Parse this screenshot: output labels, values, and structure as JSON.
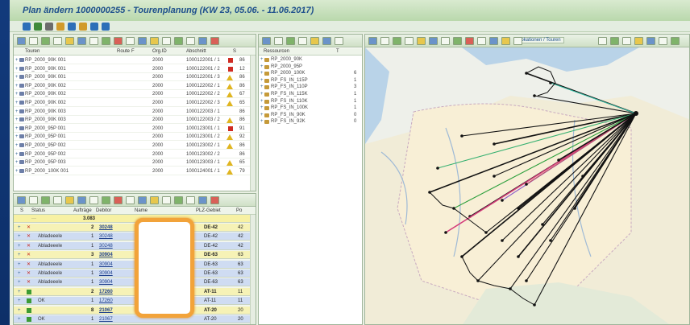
{
  "window": {
    "title": "Plan ändern 1000000255 - Tourenplanung (KW 23, 05.06. - 11.06.2017)"
  },
  "toolbar_icons": [
    "save-icon",
    "refresh-icon",
    "settings-icon",
    "calendar-icon",
    "truck-icon",
    "folder-icon",
    "print-icon",
    "exit-icon"
  ],
  "tours": {
    "columns": [
      "Touren",
      "Route",
      "F",
      "Org.ID",
      "Abschnitt",
      "S"
    ],
    "rows": [
      {
        "name": "RP_2000_90K 001",
        "org": "2000",
        "sect": "1000122001 / 1",
        "status": "red",
        "n": "86"
      },
      {
        "name": "RP_2000_90K 001",
        "org": "2000",
        "sect": "1000122001 / 2",
        "status": "red",
        "n": "12"
      },
      {
        "name": "RP_2000_90K 001",
        "org": "2000",
        "sect": "1000122001 / 3",
        "status": "warn",
        "n": "86"
      },
      {
        "name": "RP_2000_90K 002",
        "org": "2000",
        "sect": "1000122002 / 1",
        "status": "warn",
        "n": "86"
      },
      {
        "name": "RP_2000_90K 002",
        "org": "2000",
        "sect": "1000122002 / 2",
        "status": "warn",
        "n": "67"
      },
      {
        "name": "RP_2000_90K 002",
        "org": "2000",
        "sect": "1000122002 / 3",
        "status": "warn",
        "n": "65"
      },
      {
        "name": "RP_2000_90K 003",
        "org": "2000",
        "sect": "1000122003 / 1",
        "status": "",
        "n": "86"
      },
      {
        "name": "RP_2000_90K 003",
        "org": "2000",
        "sect": "1000122003 / 2",
        "status": "warn",
        "n": "86"
      },
      {
        "name": "RP_2000_95P 001",
        "org": "2000",
        "sect": "1000123001 / 1",
        "status": "red",
        "n": "91"
      },
      {
        "name": "RP_2000_95P 001",
        "org": "2000",
        "sect": "1000123001 / 2",
        "status": "warn",
        "n": "92"
      },
      {
        "name": "RP_2000_95P 002",
        "org": "2000",
        "sect": "1000123002 / 1",
        "status": "warn",
        "n": "86"
      },
      {
        "name": "RP_2000_95P 002",
        "org": "2000",
        "sect": "1000123002 / 2",
        "status": "",
        "n": "86"
      },
      {
        "name": "RP_2000_95P 003",
        "org": "2000",
        "sect": "1000123003 / 1",
        "status": "warn",
        "n": "65"
      },
      {
        "name": "RP_2000_100K 001",
        "org": "2000",
        "sect": "1000124001 / 1",
        "status": "warn",
        "n": "79"
      }
    ]
  },
  "resources": {
    "columns": [
      "Ressourcen",
      "T"
    ],
    "rows": [
      {
        "name": "RP_2000_90K",
        "n": ""
      },
      {
        "name": "RP_2000_95P",
        "n": ""
      },
      {
        "name": "RP_2000_100K",
        "n": "6"
      },
      {
        "name": "RP_FS_IN_115P",
        "n": "1"
      },
      {
        "name": "RP_FS_IN_110P",
        "n": "3"
      },
      {
        "name": "RP_FS_IN_115K",
        "n": "1"
      },
      {
        "name": "RP_FS_IN_110K",
        "n": "1"
      },
      {
        "name": "RP_FS_IN_100K",
        "n": "1"
      },
      {
        "name": "RP_FS_IN_90K",
        "n": "0"
      },
      {
        "name": "RP_FS_IN_92K",
        "n": "0"
      }
    ]
  },
  "orders": {
    "columns": [
      "S",
      "Status",
      "Aufträge",
      "Debitor",
      "Name",
      "PLZ-Gebiet",
      "Po"
    ],
    "total": "3.083",
    "rows": [
      {
        "status": "",
        "mark": "x",
        "count": "2",
        "debitor": "30248",
        "plz": "DE-42",
        "po": "42",
        "color": "#f6f2b6",
        "bold": true
      },
      {
        "status": "Abladeeele",
        "mark": "x",
        "count": "1",
        "debitor": "30248",
        "plz": "DE-42",
        "po": "42",
        "color": "#cfdcf2"
      },
      {
        "status": "Abladeeele",
        "mark": "x",
        "count": "1",
        "debitor": "30248",
        "plz": "DE-42",
        "po": "42",
        "color": "#cfdcf2"
      },
      {
        "status": "",
        "mark": "x",
        "count": "3",
        "debitor": "30904",
        "plz": "DE-63",
        "po": "63",
        "color": "#f6f2b6",
        "bold": true
      },
      {
        "status": "Abladeeele",
        "mark": "x",
        "count": "1",
        "debitor": "30904",
        "plz": "DE-63",
        "po": "63",
        "color": "#cfdcf2"
      },
      {
        "status": "Abladeeele",
        "mark": "x",
        "count": "1",
        "debitor": "30904",
        "plz": "DE-63",
        "po": "63",
        "color": "#cfdcf2"
      },
      {
        "status": "Abladeeele",
        "mark": "x",
        "count": "1",
        "debitor": "30904",
        "plz": "DE-63",
        "po": "63",
        "color": "#cfdcf2"
      },
      {
        "status": "",
        "mark": "g",
        "count": "2",
        "debitor": "17260",
        "plz": "AT-11",
        "po": "11",
        "color": "#f6f2b6",
        "bold": true
      },
      {
        "status": "OK",
        "mark": "g",
        "count": "1",
        "debitor": "17260",
        "plz": "AT-11",
        "po": "11",
        "color": "#cfdcf2"
      },
      {
        "status": "",
        "mark": "g",
        "count": "8",
        "debitor": "21067",
        "plz": "AT-20",
        "po": "20",
        "color": "#f6f2b6",
        "bold": true
      },
      {
        "status": "OK",
        "mark": "g",
        "count": "1",
        "debitor": "21067",
        "plz": "AT-20",
        "po": "20",
        "color": "#cfdcf2"
      }
    ]
  },
  "map": {
    "toolbar_label": "Lokationen / Touren"
  },
  "colors": {
    "title": "#1d4f8c",
    "highlight_box": "#f2a33a",
    "route_black": "#111111"
  }
}
